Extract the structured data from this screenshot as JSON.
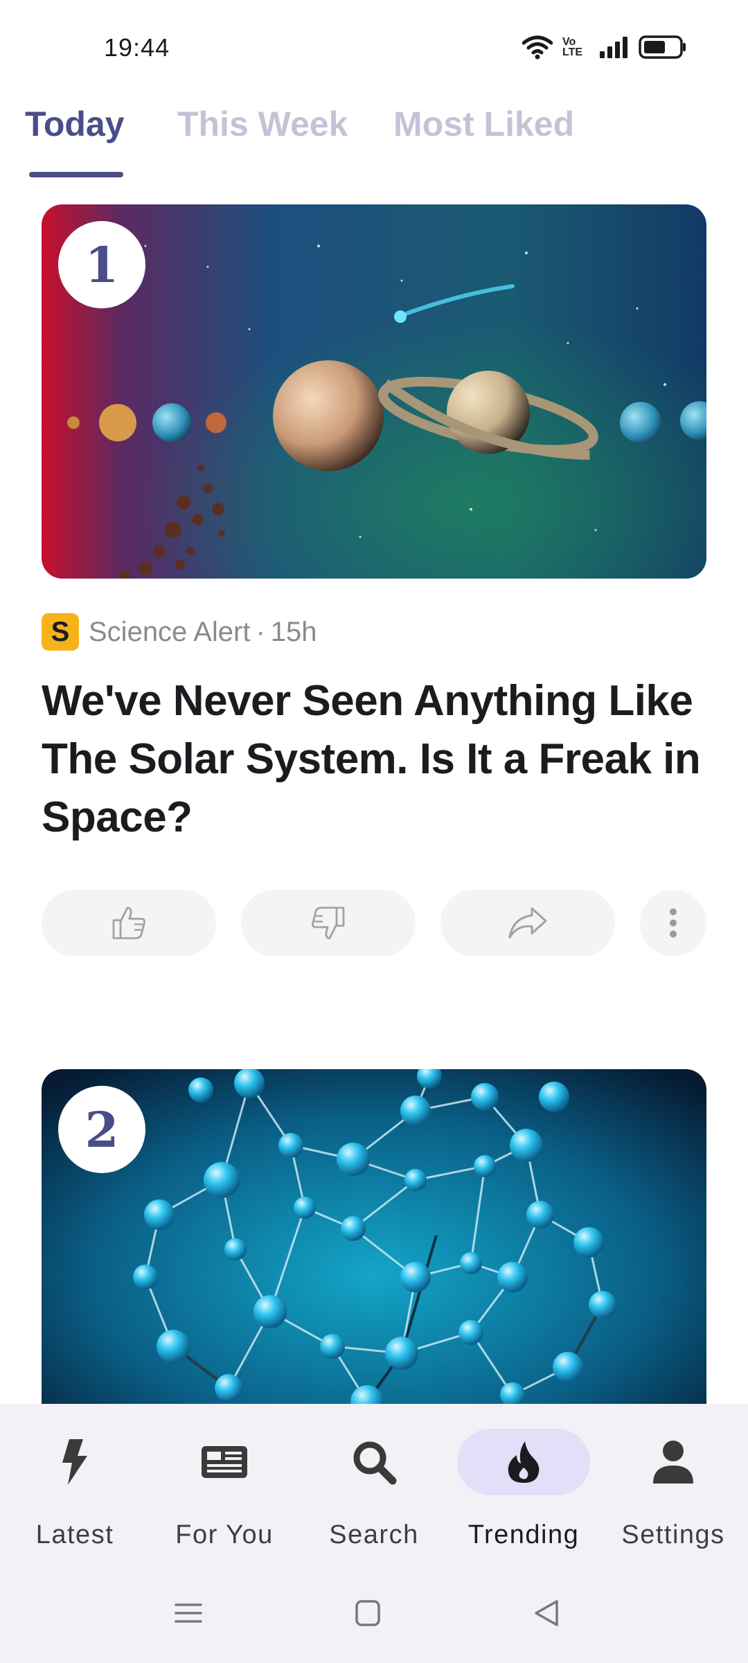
{
  "status_bar": {
    "time": "19:44",
    "network_label_top": "Vo",
    "network_label_bottom": "LTE",
    "icons": [
      "wifi-icon",
      "volte-icon",
      "signal-icon",
      "battery-icon"
    ]
  },
  "tabs": [
    {
      "label": "Today",
      "active": true
    },
    {
      "label": "This Week",
      "active": false
    },
    {
      "label": "Most Liked",
      "active": false
    }
  ],
  "articles": [
    {
      "rank": "1",
      "image_subject": "solar-system-illustration",
      "source_logo_letter": "S",
      "source": "Science Alert",
      "separator": "·",
      "age": "15h",
      "title": "We've Never Seen Anything Like The Solar System. Is It a Freak in Space?"
    },
    {
      "rank": "2",
      "image_subject": "molecule-illustration"
    }
  ],
  "actions": [
    "like-icon",
    "dislike-icon",
    "share-icon",
    "more-options-icon"
  ],
  "bottom_nav": [
    {
      "label": "Latest",
      "icon": "bolt-icon",
      "active": false
    },
    {
      "label": "For You",
      "icon": "newspaper-icon",
      "active": false
    },
    {
      "label": "Search",
      "icon": "search-icon",
      "active": false
    },
    {
      "label": "Trending",
      "icon": "flame-icon",
      "active": true
    },
    {
      "label": "Settings",
      "icon": "user-icon",
      "active": false
    }
  ],
  "colors": {
    "accent": "#4a4d88",
    "tab_inactive": "#c4c3d6",
    "active_nav_pill": "#e1e0f8",
    "nav_background": "#f3f1f6",
    "source_logo": "#f6b21a"
  }
}
